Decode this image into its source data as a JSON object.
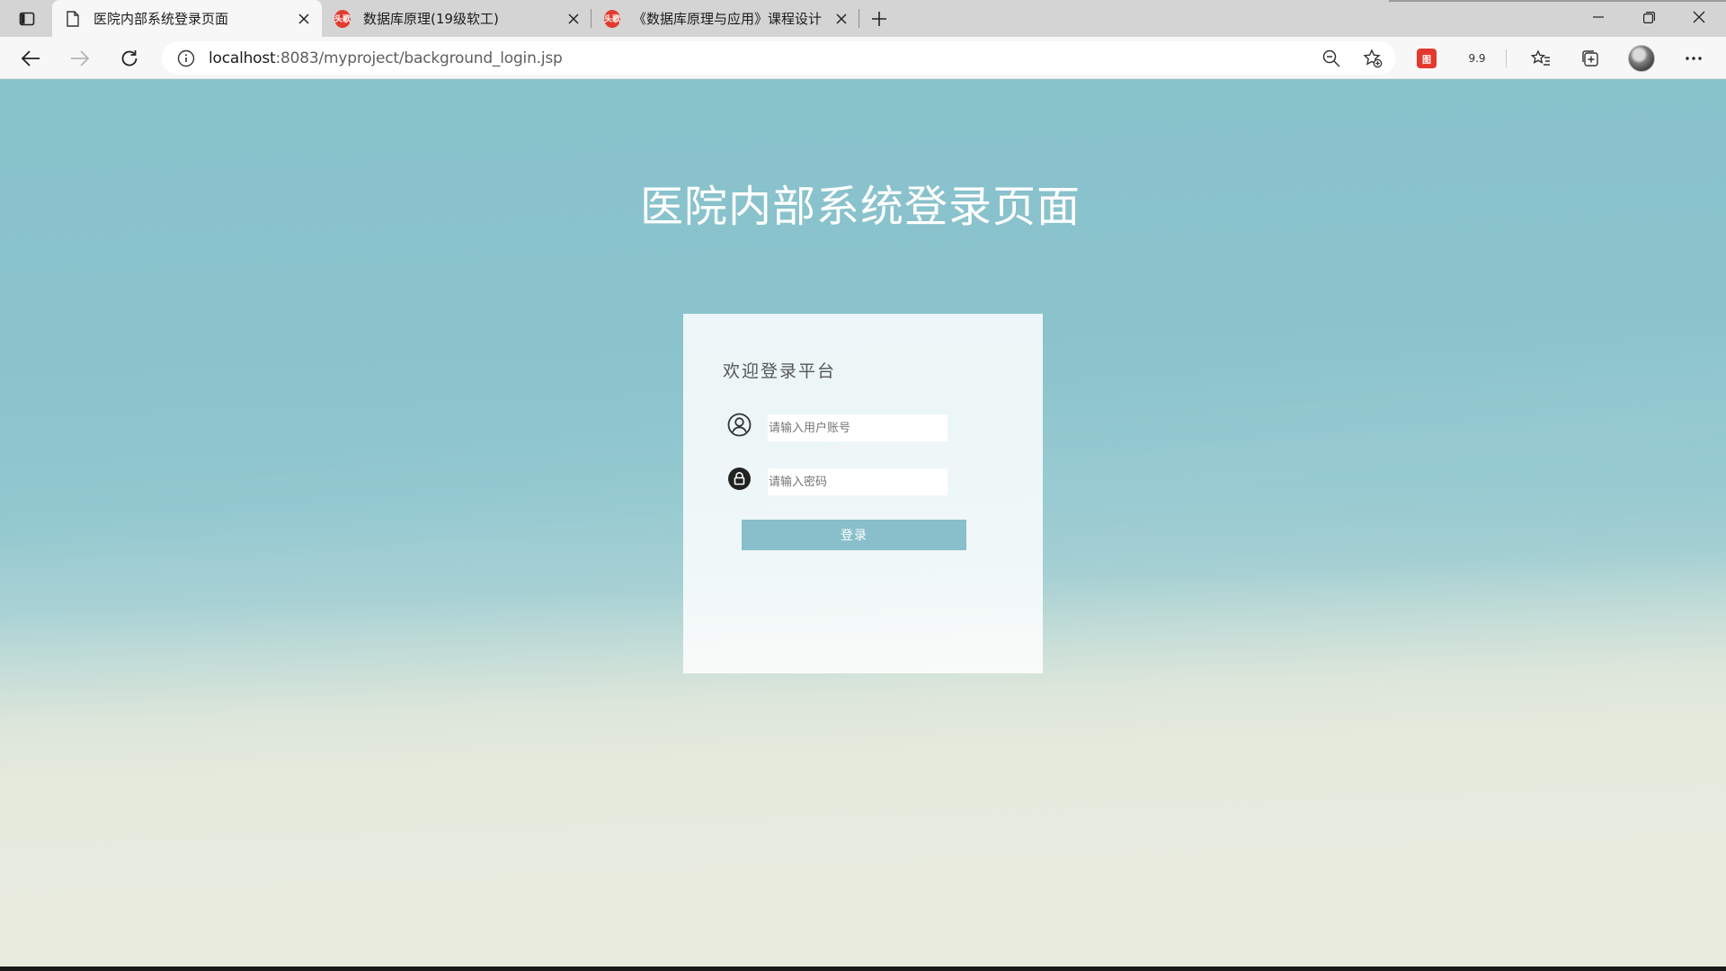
{
  "browser": {
    "tabs": [
      {
        "title": "医院内部系统登录页面",
        "favicon": "page-icon",
        "active": true
      },
      {
        "title": "数据库原理(19级软工)",
        "favicon": "red-circle-logo-icon",
        "active": false
      },
      {
        "title": "《数据库原理与应用》课程设计",
        "favicon": "red-circle-logo-icon",
        "active": false
      }
    ],
    "favicon_logo_text": "头歌",
    "url": {
      "host": "localhost",
      "rest": ":8083/myproject/background_login.jsp"
    },
    "extension_badge_text": "图",
    "extension_version_text": "9.9",
    "accent_red": "#e23a2e"
  },
  "page": {
    "title": "医院内部系统登录页面",
    "card": {
      "welcome": "欢迎登录平台",
      "username_placeholder": "请输入用户账号",
      "username_value": "",
      "password_placeholder": "请输入密码",
      "password_value": "",
      "login_label": "登录"
    },
    "colors": {
      "background_top": "#88c2cb",
      "background_bottom": "#e9ebdf",
      "button": "#88bfca"
    }
  }
}
